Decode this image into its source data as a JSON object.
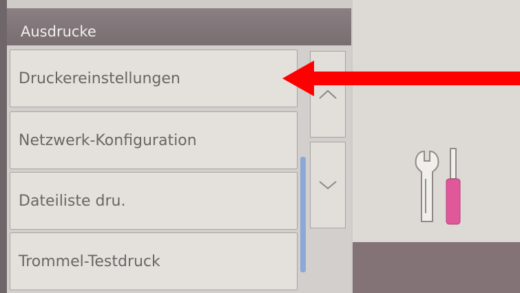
{
  "header": {
    "title": "Ausdrucke"
  },
  "menu": {
    "items": [
      {
        "label": "Druckereinstellungen"
      },
      {
        "label": "Netzwerk-Konfiguration"
      },
      {
        "label": "Dateiliste dru."
      },
      {
        "label": "Trommel-Testdruck"
      }
    ]
  },
  "icons": {
    "scroll_up": "chevron-up-icon",
    "scroll_down": "chevron-down-icon",
    "tools": "tools-icon"
  },
  "colors": {
    "title_bar": "#7f7477",
    "arrow": "#ff0000",
    "scroll_indicator": "#8ca8d6",
    "screwdriver": "#e0589a"
  }
}
